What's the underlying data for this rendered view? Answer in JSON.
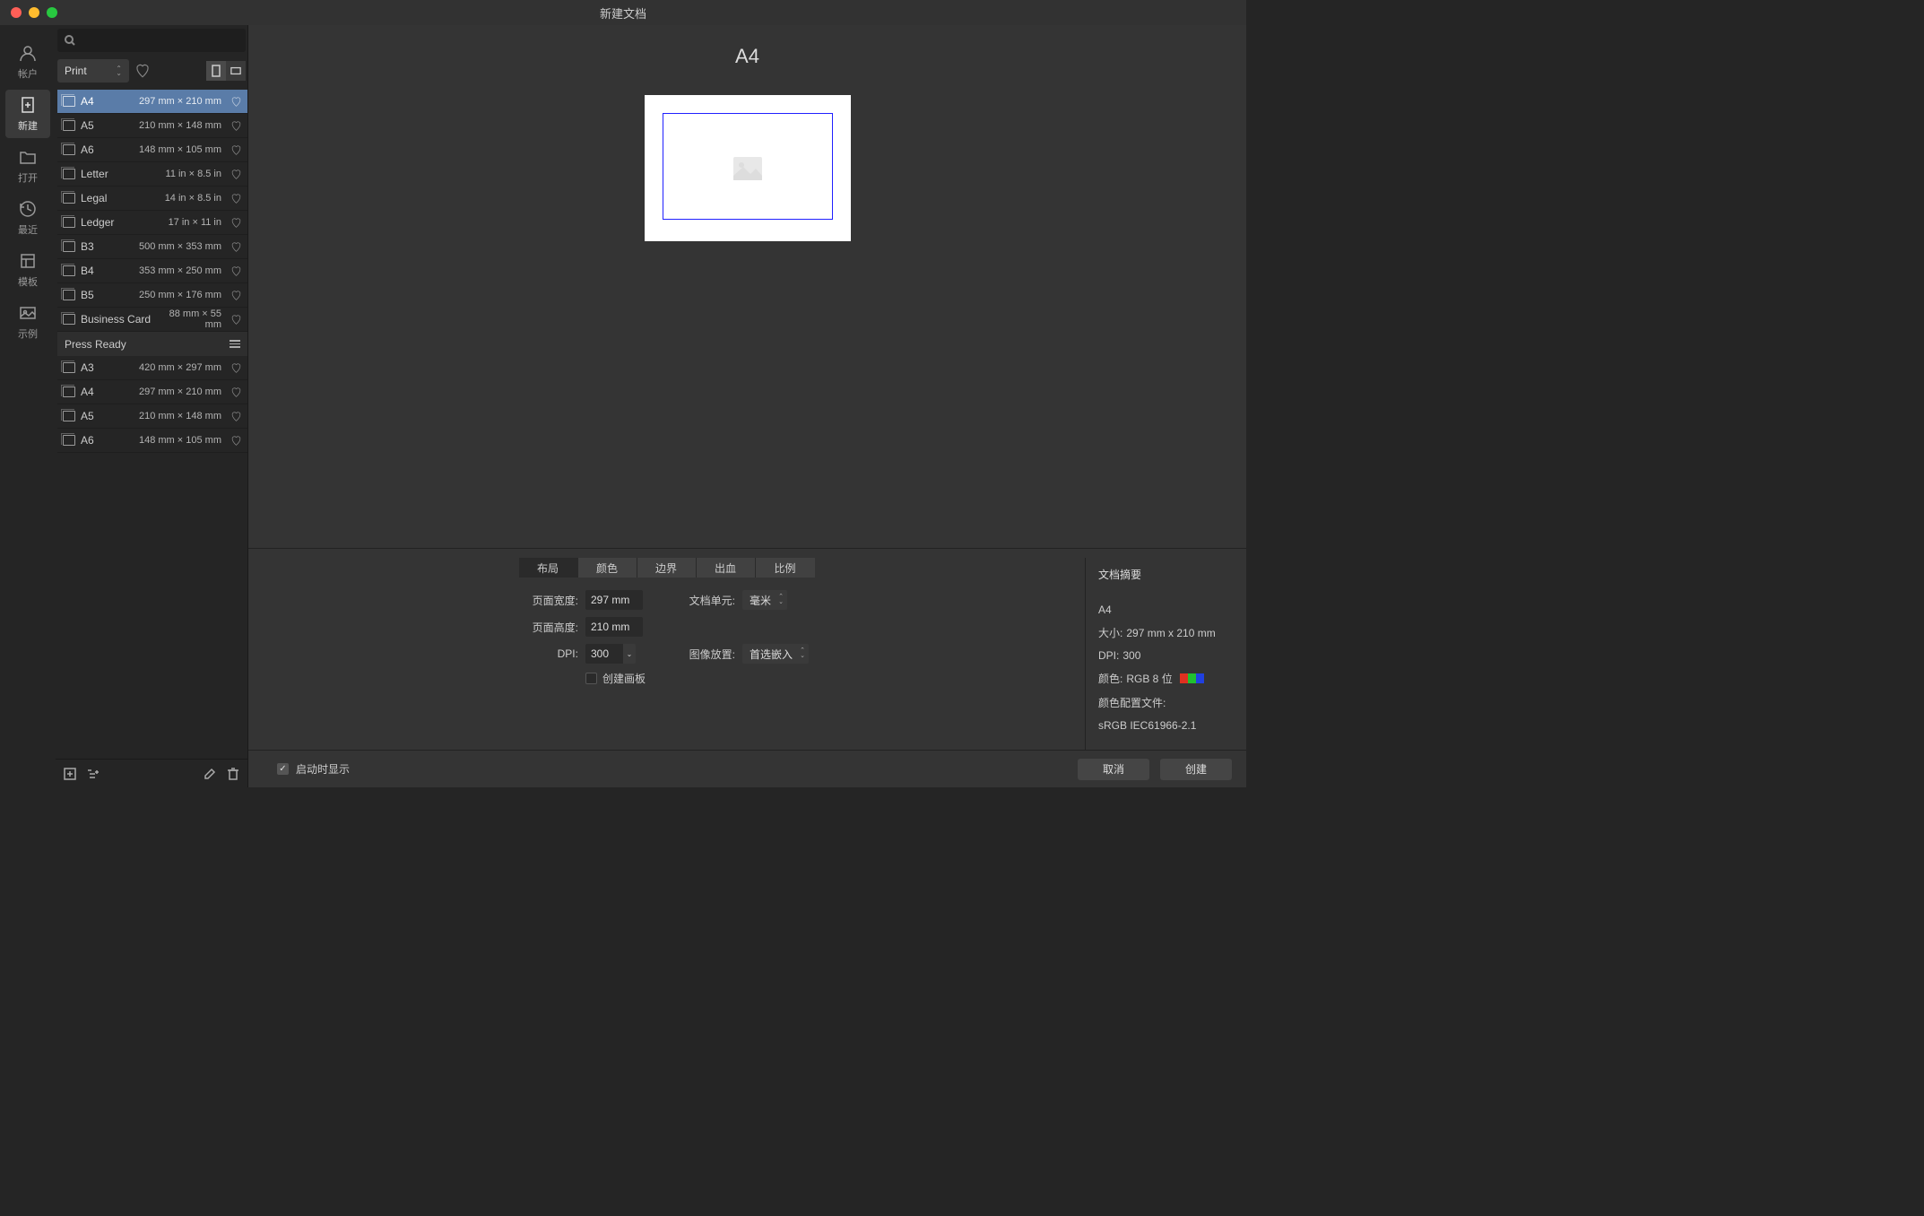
{
  "window_title": "新建文档",
  "rail": [
    {
      "label": "帐户",
      "icon": "user"
    },
    {
      "label": "新建",
      "icon": "new",
      "active": true
    },
    {
      "label": "打开",
      "icon": "folder"
    },
    {
      "label": "最近",
      "icon": "recent"
    },
    {
      "label": "模板",
      "icon": "template"
    },
    {
      "label": "示例",
      "icon": "samples"
    }
  ],
  "category": "Print",
  "presets": [
    {
      "name": "A4",
      "size": "297 mm × 210 mm",
      "selected": true
    },
    {
      "name": "A5",
      "size": "210 mm × 148 mm"
    },
    {
      "name": "A6",
      "size": "148 mm × 105 mm"
    },
    {
      "name": "Letter",
      "size": "11 in × 8.5 in"
    },
    {
      "name": "Legal",
      "size": "14 in × 8.5 in"
    },
    {
      "name": "Ledger",
      "size": "17 in × 11 in"
    },
    {
      "name": "B3",
      "size": "500 mm × 353 mm"
    },
    {
      "name": "B4",
      "size": "353 mm × 250 mm"
    },
    {
      "name": "B5",
      "size": "250 mm × 176 mm"
    },
    {
      "name": "Business Card",
      "size": "88 mm × 55 mm"
    }
  ],
  "section_label": "Press Ready",
  "presets2": [
    {
      "name": "A3",
      "size": "420 mm × 297 mm"
    },
    {
      "name": "A4",
      "size": "297 mm × 210 mm"
    },
    {
      "name": "A5",
      "size": "210 mm × 148 mm"
    },
    {
      "name": "A6",
      "size": "148 mm × 105 mm"
    }
  ],
  "preview_title": "A4",
  "tabs": [
    "布局",
    "颜色",
    "边界",
    "出血",
    "比例"
  ],
  "active_tab": 0,
  "form": {
    "page_width_label": "页面宽度:",
    "page_width": "297 mm",
    "page_height_label": "页面高度:",
    "page_height": "210 mm",
    "dpi_label": "DPI:",
    "dpi": "300",
    "create_artboard_label": "创建画板",
    "doc_units_label": "文档单元:",
    "doc_units": "毫米",
    "image_placement_label": "图像放置:",
    "image_placement": "首选嵌入"
  },
  "summary": {
    "title": "文档摘要",
    "name": "A4",
    "size_label": "大小:",
    "size": "297 mm x 210 mm",
    "dpi_label": "DPI:",
    "dpi": "300",
    "color_label": "颜色:",
    "color": "RGB 8 位",
    "profile_label": "颜色配置文件:",
    "profile": "sRGB IEC61966-2.1"
  },
  "show_on_startup": "启动时显示",
  "cancel": "取消",
  "create": "创建"
}
